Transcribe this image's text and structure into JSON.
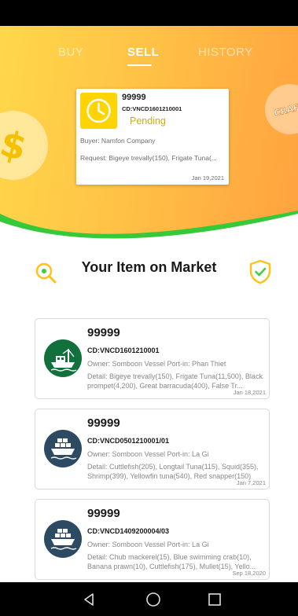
{
  "tabs": [
    {
      "label": "BUY",
      "active": false
    },
    {
      "label": "SELL",
      "active": true
    },
    {
      "label": "HISTORY",
      "active": false
    }
  ],
  "coin_right_text": "CRAFT",
  "pending_card": {
    "number": "99999",
    "code": "CD:VNCD1601210001",
    "status": "Pending",
    "buyer": "Buyer: Namfon Company",
    "request": "Request: Bigeye trevally(150), Frigate Tuna(...",
    "date": "Jan 19,2021",
    "icon": "clock-icon",
    "color": "#ffd400"
  },
  "section_title": "Your Item on Market",
  "items": [
    {
      "number": "99999",
      "code": "CD:VNCD1601210001",
      "owner": "Owner: Somboon Vessel  Port-in: Phan Thiet",
      "detail": "Detail: Bigeye trevally(150), Frigate Tuna(11,500), Black prompet(4,200), Great barracuda(400), False Tr...",
      "date": "Jan 18,2021",
      "icon": "fishing-boat-icon",
      "avatar_color": "#12703d"
    },
    {
      "number": "99999",
      "code": "CD:VNCD0501210001/01",
      "owner": "Owner: Somboon Vessel  Port-in: La Gi",
      "detail": "Detail: Cuttlefish(205), Longtail Tuna(115), Squid(355), Shrimp(399), Yellowfin tuna(540), Red snapper(150)",
      "date": "Jan 7,2021",
      "icon": "cargo-ship-icon",
      "avatar_color": "#2d4a63"
    },
    {
      "number": "99999",
      "code": "CD:VNCD1409200004/03",
      "owner": "Owner: Somboon Vessel  Port-in: La Gi",
      "detail": "Detail: Chub mackerel(15), Blue swimming crab(10), Banana prawn(10), Cuttlefish(175), Mullet(15), Yello...",
      "date": "Sep 18,2020",
      "icon": "cargo-ship-icon",
      "avatar_color": "#2d4a63"
    }
  ],
  "colors": {
    "hero_start": "#ffd84a",
    "hero_end": "#ffa23f",
    "accent_green": "#3ecf3a",
    "pending_text": "#c9b200",
    "icon_yellow": "#ffc21a"
  }
}
